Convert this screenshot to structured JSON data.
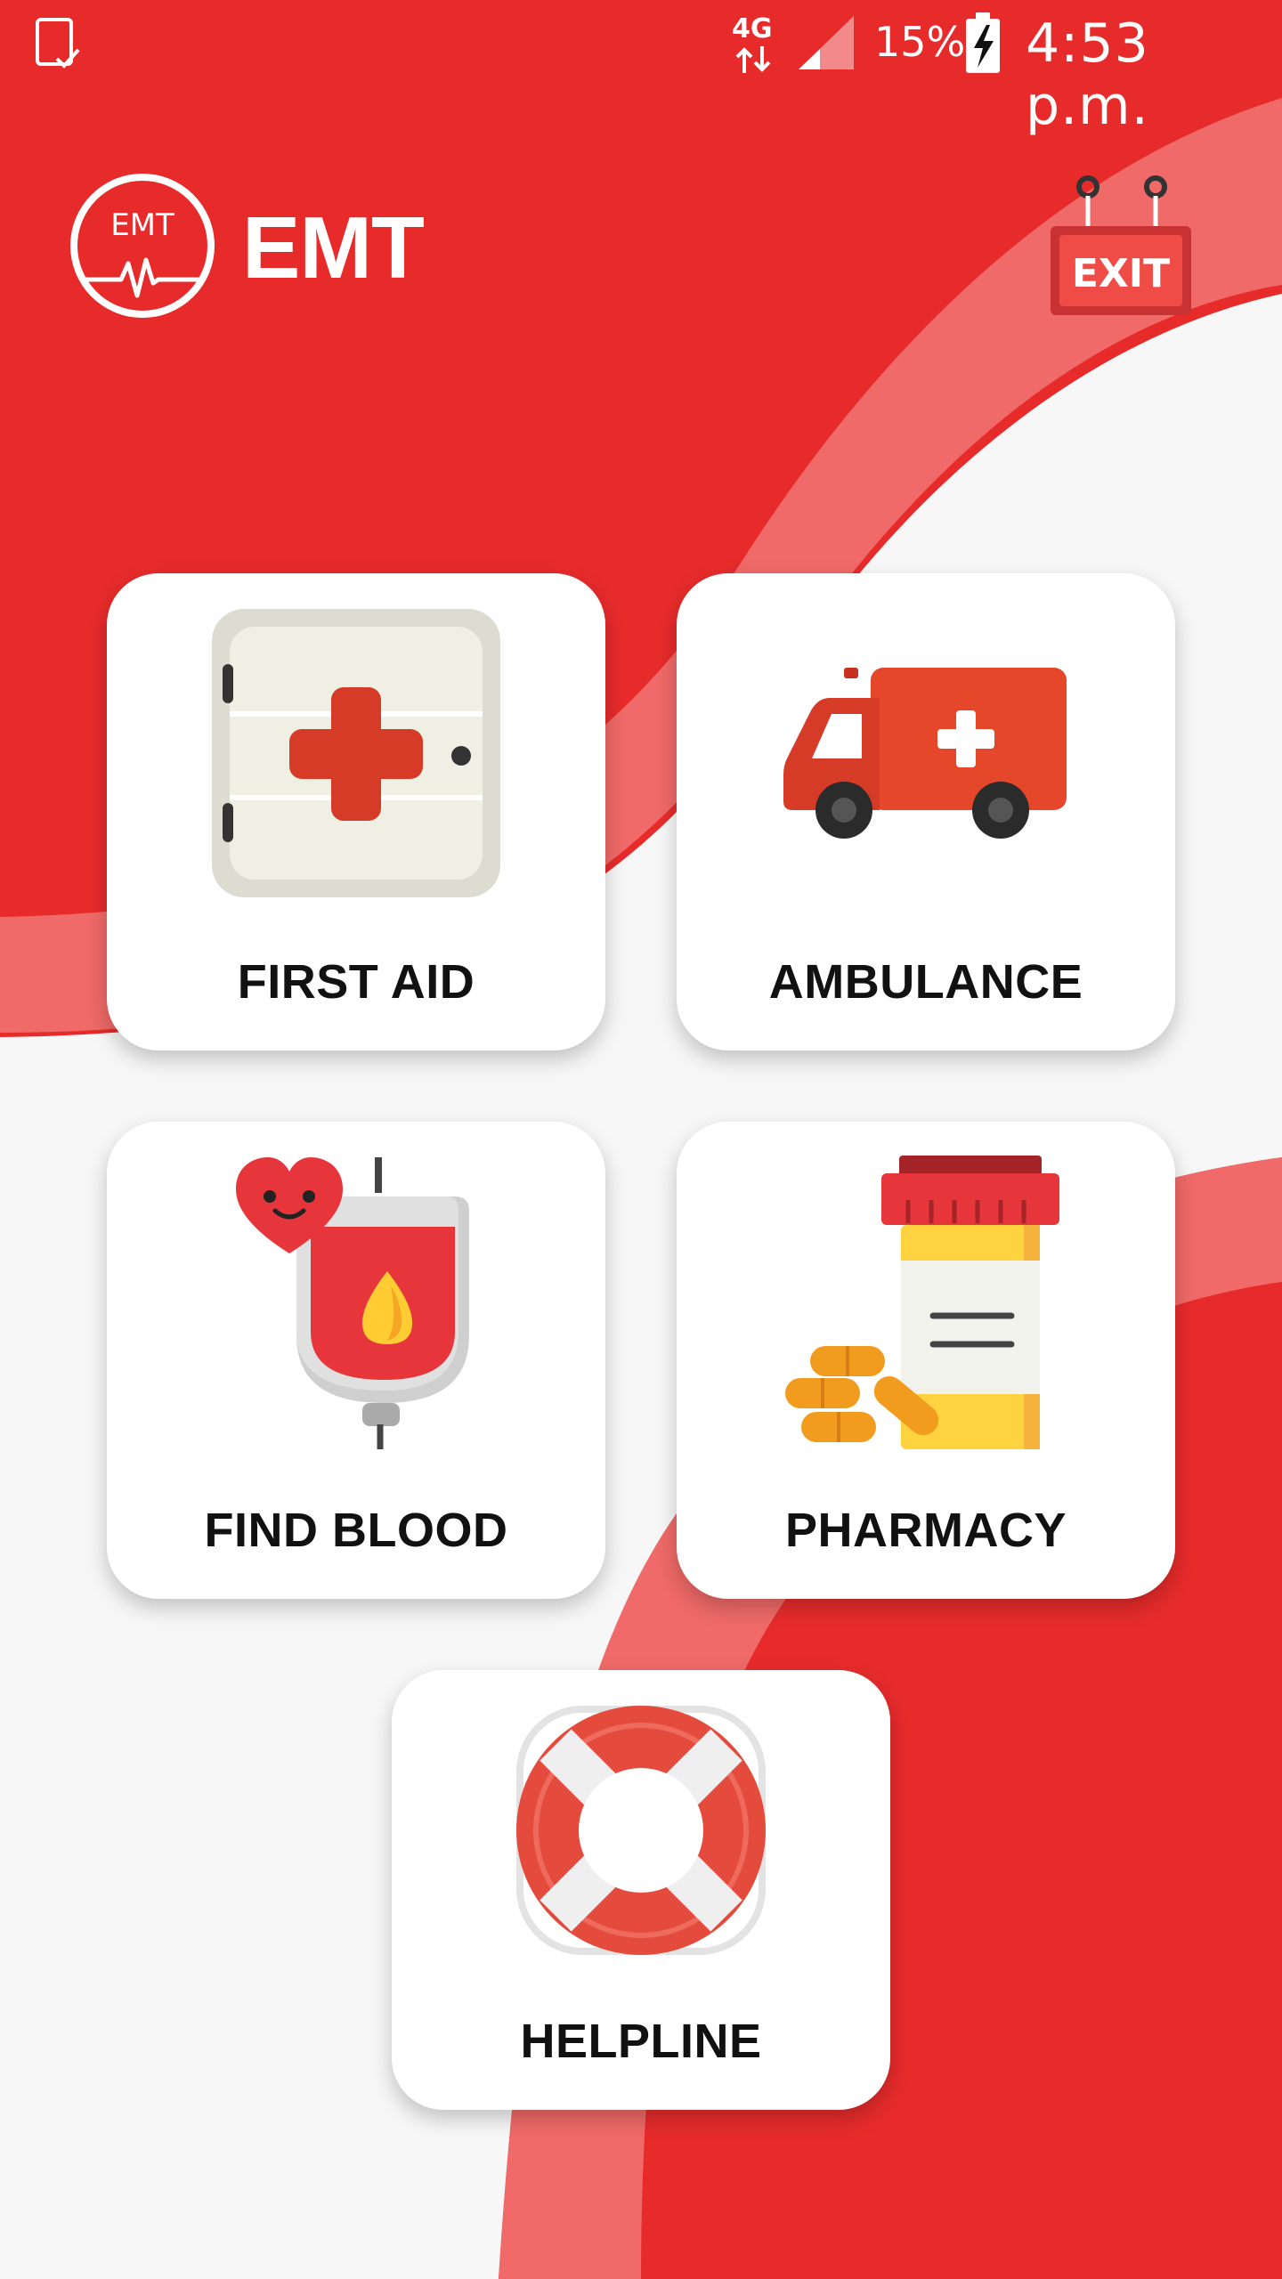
{
  "status_bar": {
    "network": "4G",
    "battery_percent": "15%",
    "time": "4:53 p.m."
  },
  "app": {
    "logo_text": "EMT",
    "title": "EMT",
    "exit_label": "EXIT"
  },
  "menu": {
    "first_aid": "FIRST AID",
    "ambulance": "AMBULANCE",
    "find_blood": "FIND BLOOD",
    "pharmacy": "PHARMACY",
    "helpline": "HELPLINE"
  },
  "colors": {
    "primary_red": "#e72b2b",
    "band_pink": "#ef6a68",
    "light_bg": "#f7f7f7"
  }
}
